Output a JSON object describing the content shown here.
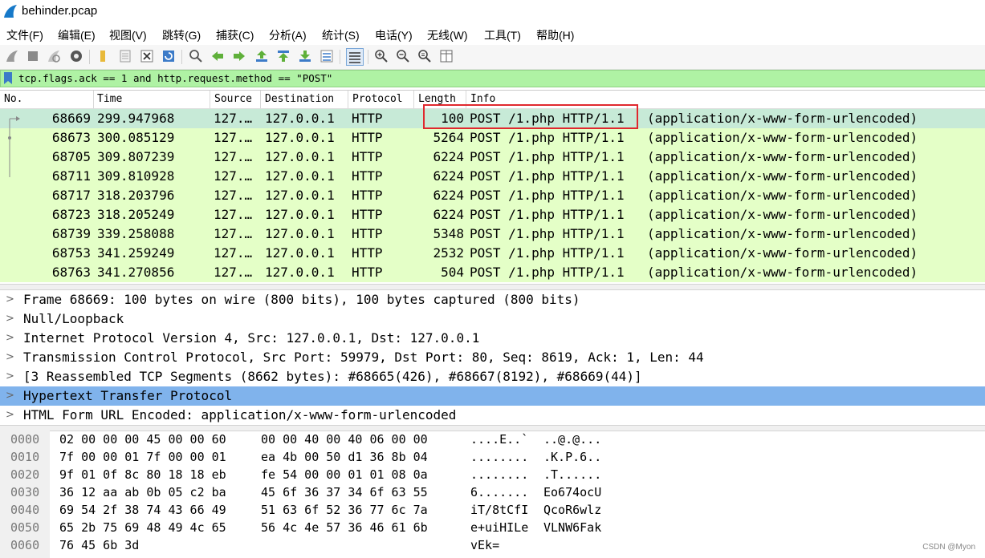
{
  "window": {
    "title": "behinder.pcap"
  },
  "menu": [
    "文件(F)",
    "编辑(E)",
    "视图(V)",
    "跳转(G)",
    "捕获(C)",
    "分析(A)",
    "统计(S)",
    "电话(Y)",
    "无线(W)",
    "工具(T)",
    "帮助(H)"
  ],
  "filter": {
    "value": "tcp.flags.ack == 1 and http.request.method == \"POST\""
  },
  "columns": [
    "No.",
    "Time",
    "Source",
    "Destination",
    "Protocol",
    "Length",
    "Info"
  ],
  "packets": [
    {
      "no": "68669",
      "time": "299.947968",
      "src": "127.…",
      "dst": "127.0.0.1",
      "proto": "HTTP",
      "len": "100",
      "info": "POST /1.php HTTP/1.1",
      "extra": "(application/x-www-form-urlencoded)",
      "selected": true
    },
    {
      "no": "68673",
      "time": "300.085129",
      "src": "127.…",
      "dst": "127.0.0.1",
      "proto": "HTTP",
      "len": "5264",
      "info": "POST /1.php HTTP/1.1",
      "extra": "(application/x-www-form-urlencoded)"
    },
    {
      "no": "68705",
      "time": "309.807239",
      "src": "127.…",
      "dst": "127.0.0.1",
      "proto": "HTTP",
      "len": "6224",
      "info": "POST /1.php HTTP/1.1",
      "extra": "(application/x-www-form-urlencoded)"
    },
    {
      "no": "68711",
      "time": "309.810928",
      "src": "127.…",
      "dst": "127.0.0.1",
      "proto": "HTTP",
      "len": "6224",
      "info": "POST /1.php HTTP/1.1",
      "extra": "(application/x-www-form-urlencoded)"
    },
    {
      "no": "68717",
      "time": "318.203796",
      "src": "127.…",
      "dst": "127.0.0.1",
      "proto": "HTTP",
      "len": "6224",
      "info": "POST /1.php HTTP/1.1",
      "extra": "(application/x-www-form-urlencoded)"
    },
    {
      "no": "68723",
      "time": "318.205249",
      "src": "127.…",
      "dst": "127.0.0.1",
      "proto": "HTTP",
      "len": "6224",
      "info": "POST /1.php HTTP/1.1",
      "extra": "(application/x-www-form-urlencoded)"
    },
    {
      "no": "68739",
      "time": "339.258088",
      "src": "127.…",
      "dst": "127.0.0.1",
      "proto": "HTTP",
      "len": "5348",
      "info": "POST /1.php HTTP/1.1",
      "extra": "(application/x-www-form-urlencoded)"
    },
    {
      "no": "68753",
      "time": "341.259249",
      "src": "127.…",
      "dst": "127.0.0.1",
      "proto": "HTTP",
      "len": "2532",
      "info": "POST /1.php HTTP/1.1",
      "extra": "(application/x-www-form-urlencoded)"
    },
    {
      "no": "68763",
      "time": "341.270856",
      "src": "127.…",
      "dst": "127.0.0.1",
      "proto": "HTTP",
      "len": "504",
      "info": "POST /1.php HTTP/1.1",
      "extra": "(application/x-www-form-urlencoded)"
    }
  ],
  "details": [
    {
      "text": "Frame 68669: 100 bytes on wire (800 bits), 100 bytes captured (800 bits)"
    },
    {
      "text": "Null/Loopback"
    },
    {
      "text": "Internet Protocol Version 4, Src: 127.0.0.1, Dst: 127.0.0.1"
    },
    {
      "text": "Transmission Control Protocol, Src Port: 59979, Dst Port: 80, Seq: 8619, Ack: 1, Len: 44"
    },
    {
      "text": "[3 Reassembled TCP Segments (8662 bytes): #68665(426), #68667(8192), #68669(44)]"
    },
    {
      "text": "Hypertext Transfer Protocol",
      "selected": true
    },
    {
      "text": "HTML Form URL Encoded: application/x-www-form-urlencoded"
    }
  ],
  "hex": [
    {
      "off": "0000",
      "b1": "02 00 00 00 45 00 00 60",
      "b2": "00 00 40 00 40 06 00 00",
      "a1": "....E..`",
      "a2": "..@.@..."
    },
    {
      "off": "0010",
      "b1": "7f 00 00 01 7f 00 00 01",
      "b2": "ea 4b 00 50 d1 36 8b 04",
      "a1": "........",
      "a2": ".K.P.6.."
    },
    {
      "off": "0020",
      "b1": "9f 01 0f 8c 80 18 18 eb",
      "b2": "fe 54 00 00 01 01 08 0a",
      "a1": "........",
      "a2": ".T......"
    },
    {
      "off": "0030",
      "b1": "36 12 aa ab 0b 05 c2 ba",
      "b2": "45 6f 36 37 34 6f 63 55",
      "a1": "6.......",
      "a2": "Eo674ocU"
    },
    {
      "off": "0040",
      "b1": "69 54 2f 38 74 43 66 49",
      "b2": "51 63 6f 52 36 77 6c 7a",
      "a1": "iT/8tCfI",
      "a2": "QcoR6wlz"
    },
    {
      "off": "0050",
      "b1": "65 2b 75 69 48 49 4c 65",
      "b2": "56 4c 4e 57 36 46 61 6b",
      "a1": "e+uiHILe",
      "a2": "VLNW6Fak"
    },
    {
      "off": "0060",
      "b1": "76 45 6b 3d",
      "b2": "",
      "a1": "vEk=",
      "a2": ""
    }
  ],
  "watermark": "CSDN @Myon⁠",
  "colors": {
    "row": "#e4ffc7",
    "row_selected": "#c7ead7",
    "filter_bg": "#aff2a4",
    "detail_selected": "#80b3ec",
    "highlight_box": "#e0282e"
  }
}
